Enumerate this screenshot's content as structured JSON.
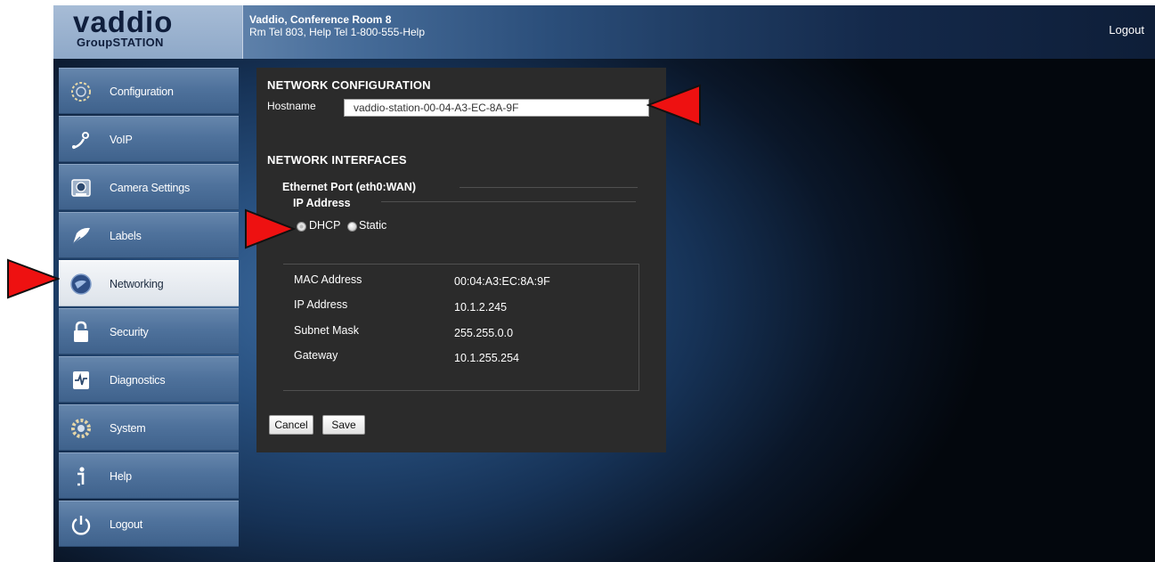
{
  "header": {
    "logo_word": "vaddio",
    "logo_sub": "GroupSTATION",
    "site_name": "Vaddio, Conference Room 8",
    "site_phone": "Rm Tel 803, Help Tel 1-800-555-Help",
    "logout_label": "Logout"
  },
  "sidebar": {
    "items": [
      {
        "label": "Configuration",
        "icon": "configuration-icon"
      },
      {
        "label": "VoIP",
        "icon": "voip-icon"
      },
      {
        "label": "Camera Settings",
        "icon": "camera-icon"
      },
      {
        "label": "Labels",
        "icon": "labels-icon"
      },
      {
        "label": "Networking",
        "icon": "networking-icon",
        "active": true
      },
      {
        "label": "Security",
        "icon": "lock-icon"
      },
      {
        "label": "Diagnostics",
        "icon": "diagnostics-icon"
      },
      {
        "label": "System",
        "icon": "system-gear-icon"
      },
      {
        "label": "Help",
        "icon": "help-info-icon"
      },
      {
        "label": "Logout",
        "icon": "power-icon"
      }
    ]
  },
  "network": {
    "config_title": "NETWORK CONFIGURATION",
    "hostname_label": "Hostname",
    "hostname_value": "vaddio-station-00-04-A3-EC-8A-9F",
    "interfaces_title": "NETWORK INTERFACES",
    "ethernet_title": "Ethernet Port (eth0:WAN)",
    "ip_title": "IP Address",
    "mode_options": [
      "DHCP",
      "Static"
    ],
    "mode_selected": "DHCP",
    "rows": [
      {
        "label": "MAC Address",
        "value": "00:04:A3:EC:8A:9F"
      },
      {
        "label": "IP Address",
        "value": "10.1.2.245"
      },
      {
        "label": "Subnet Mask",
        "value": "255.255.0.0"
      },
      {
        "label": "Gateway",
        "value": "10.1.255.254"
      }
    ],
    "cancel_label": "Cancel",
    "save_label": "Save"
  },
  "colors": {
    "callout_red": "#ee1111",
    "panel_bg": "#2b2b2b",
    "nav_blue": "#4f729c"
  }
}
